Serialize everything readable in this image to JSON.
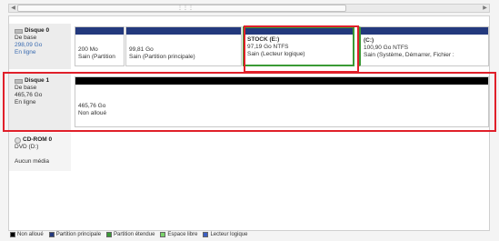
{
  "disk0": {
    "title": "Disque 0",
    "type": "De base",
    "size": "298,09 Go",
    "status": "En ligne",
    "partitions": [
      {
        "size": "200 Mo",
        "status": "Sain (Partition"
      },
      {
        "size": "99,81 Go",
        "status": "Sain (Partition principale)"
      },
      {
        "name": "STOCK  (E:)",
        "size": "97,19 Go NTFS",
        "status": "Sain (Lecteur logique)"
      },
      {
        "name": "(C:)",
        "size": "100,90 Go NTFS",
        "status": "Sain (Système, Démarrer, Fichier :"
      }
    ]
  },
  "disk1": {
    "title": "Disque 1",
    "type": "De base",
    "size": "465,76 Go",
    "status": "En ligne",
    "partition": {
      "size": "465,76 Go",
      "status": "Non alloué"
    }
  },
  "cdrom": {
    "title": "CD-ROM 0",
    "label": "DVD (D:)",
    "status": "Aucun média"
  },
  "legend": [
    {
      "label": "Non alloué",
      "color": "#000000"
    },
    {
      "label": "Partition principale",
      "color": "#23397d"
    },
    {
      "label": "Partition étendue",
      "color": "#3a9a35"
    },
    {
      "label": "Espace libre",
      "color": "#7ad36a"
    },
    {
      "label": "Lecteur logique",
      "color": "#3d5fc4"
    }
  ],
  "colors": {
    "highlight": "#e0202a",
    "primary": "#23397d",
    "logical": "#3a9a35",
    "unallocated": "#000000"
  }
}
